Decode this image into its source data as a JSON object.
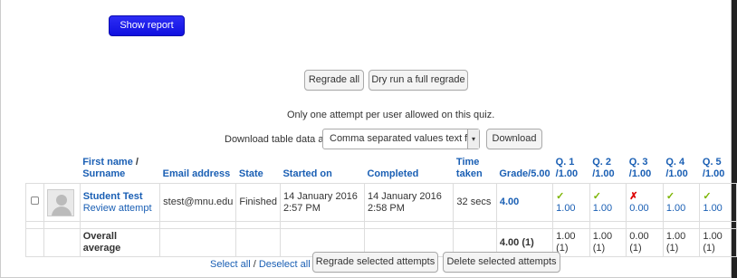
{
  "show_report_label": "Show report",
  "regrade_all_label": "Regrade all",
  "dry_run_label": "Dry run a full regrade",
  "notice": "Only one attempt per user allowed on this quiz.",
  "download": {
    "label": "Download table data as",
    "format": "Comma separated values text file",
    "button": "Download"
  },
  "table": {
    "headers": {
      "first_name": "First name",
      "surname": "Surname",
      "slash": " /",
      "email": "Email address",
      "state": "State",
      "started": "Started on",
      "completed": "Completed",
      "time": "Time",
      "taken": "taken",
      "grade": "Grade/5.00",
      "q1": "Q. 1",
      "q2": "Q. 2",
      "q3": "Q. 3",
      "q4": "Q. 4",
      "q5": "Q. 5",
      "qmax": "/1.00"
    },
    "row": {
      "name": "Student Test",
      "review": "Review attempt",
      "email": "stest@mnu.edu",
      "state": "Finished",
      "started_date": "14 January 2016",
      "started_time": "2:57 PM",
      "completed_date": "14 January 2016",
      "completed_time": "2:58 PM",
      "time_taken": "32 secs",
      "grade": "4.00",
      "q1": "1.00",
      "q2": "1.00",
      "q3": "0.00",
      "q4": "1.00",
      "q5": "1.00",
      "check_glyph": "✓",
      "cross_glyph": "✗"
    },
    "average": {
      "label": "Overall average",
      "grade": "4.00 (1)",
      "q1": "1.00 (1)",
      "q2": "1.00 (1)",
      "q3": "0.00 (1)",
      "q4": "1.00 (1)",
      "q5": "1.00 (1)"
    }
  },
  "select_all": "Select all",
  "sep": " / ",
  "deselect_all": "Deselect all",
  "regrade_selected_label": "Regrade selected attempts",
  "delete_selected_label": "Delete selected attempts",
  "colors": {
    "link": "#1a5fb4",
    "primary": "#1a1aff",
    "correct": "#7bb400",
    "incorrect": "#dd0000"
  }
}
